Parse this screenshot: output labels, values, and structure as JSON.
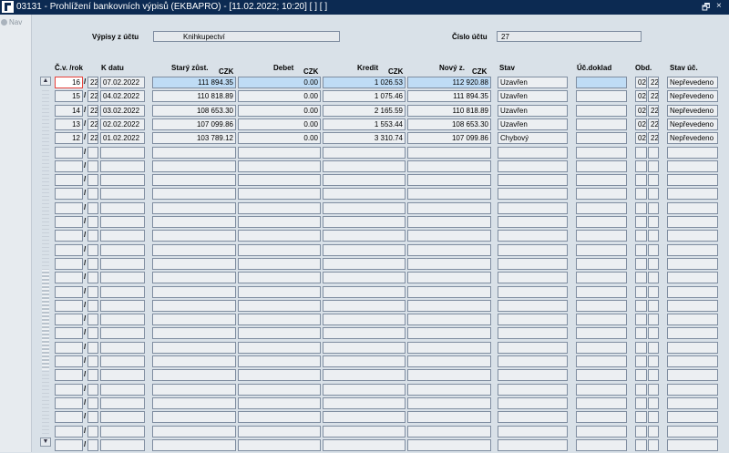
{
  "window": {
    "title": "03131 - Prohlížení bankovních výpisů (EKBAPRO) - [11.02.2022; 10:20]  [ ]  [ ]",
    "restore_glyph": "🗗",
    "close_glyph": "×"
  },
  "left_panel": {
    "nav_label": "Nav"
  },
  "header": {
    "vypisy_label": "Výpisy z účtu",
    "vypisy_value": "Knihkupectví",
    "cislo_label": "Číslo účtu",
    "cislo_value": "27"
  },
  "columns": {
    "cv_rok": "Č.v. /rok",
    "k_datu": "K datu",
    "stary": "Starý zůst.",
    "debet": "Debet",
    "kredit": "Kredit",
    "novy": "Nový z.",
    "stav": "Stav",
    "ucdoklad": "Úč.doklad",
    "obd": "Obd.",
    "stav_uc": "Stav úč.",
    "currency": "CZK",
    "slash": "/"
  },
  "rows": [
    {
      "cv": "16",
      "rok": "22",
      "datum": "07.02.2022",
      "stary": "111 894.35",
      "debet": "0.00",
      "kredit": "1 026.53",
      "novy": "112 920.88",
      "stav": "Uzavřen",
      "ucdoklad": "",
      "obd1": "02",
      "obd2": "22",
      "stav_uc": "Nepřevedeno"
    },
    {
      "cv": "15",
      "rok": "22",
      "datum": "04.02.2022",
      "stary": "110 818.89",
      "debet": "0.00",
      "kredit": "1 075.46",
      "novy": "111 894.35",
      "stav": "Uzavřen",
      "ucdoklad": "",
      "obd1": "02",
      "obd2": "22",
      "stav_uc": "Nepřevedeno"
    },
    {
      "cv": "14",
      "rok": "22",
      "datum": "03.02.2022",
      "stary": "108 653.30",
      "debet": "0.00",
      "kredit": "2 165.59",
      "novy": "110 818.89",
      "stav": "Uzavřen",
      "ucdoklad": "",
      "obd1": "02",
      "obd2": "22",
      "stav_uc": "Nepřevedeno"
    },
    {
      "cv": "13",
      "rok": "22",
      "datum": "02.02.2022",
      "stary": "107 099.86",
      "debet": "0.00",
      "kredit": "1 553.44",
      "novy": "108 653.30",
      "stav": "Uzavřen",
      "ucdoklad": "",
      "obd1": "02",
      "obd2": "22",
      "stav_uc": "Nepřevedeno"
    },
    {
      "cv": "12",
      "rok": "22",
      "datum": "01.02.2022",
      "stary": "103 789.12",
      "debet": "0.00",
      "kredit": "3 310.74",
      "novy": "107 099.86",
      "stav": "Chybový",
      "ucdoklad": "",
      "obd1": "02",
      "obd2": "22",
      "stav_uc": "Nepřevedeno"
    }
  ],
  "empty_rows_count": 22,
  "scrollbar": {
    "up_glyph": "▲",
    "down_glyph": "▼"
  }
}
